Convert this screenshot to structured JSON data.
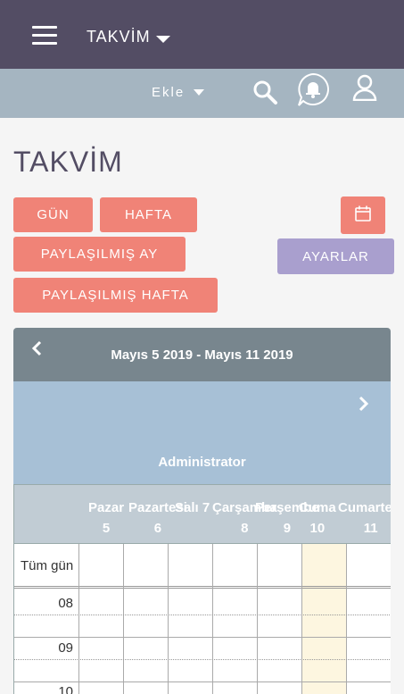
{
  "header": {
    "module_title": "TAKVİM"
  },
  "subheader": {
    "add_label": "Ekle"
  },
  "page": {
    "title": "TAKVİM"
  },
  "view_buttons": {
    "day": "GÜN",
    "week": "HAFTA",
    "shared_month": "PAYLAŞILMIŞ AY",
    "shared_week": "PAYLAŞILMIŞ HAFTA",
    "settings": "AYARLAR"
  },
  "calendar": {
    "date_range": "Mayıs 5 2019 - Mayıs 11 2019",
    "user": "Administrator",
    "allday_label": "Tüm gün",
    "days": [
      {
        "name": "Pazar",
        "num": "5"
      },
      {
        "name": "Pazartesi",
        "num": "6"
      },
      {
        "name": "Salı 7",
        "num": ""
      },
      {
        "name": "Çarşamba",
        "num": "8"
      },
      {
        "name": "Perşembe",
        "num": "9"
      },
      {
        "name": "Cuma",
        "num": "10"
      },
      {
        "name": "Cumartesi",
        "num": "11"
      }
    ],
    "hours": [
      "08",
      "09",
      "10"
    ]
  },
  "colors": {
    "topbar": "#534d64",
    "subbar": "#a5b5c1",
    "primary_button": "#f08377",
    "settings_button": "#a99fce",
    "calendar_header": "#78868e",
    "user_band": "#a7c0d6",
    "today_highlight": "#fdf6e0"
  }
}
